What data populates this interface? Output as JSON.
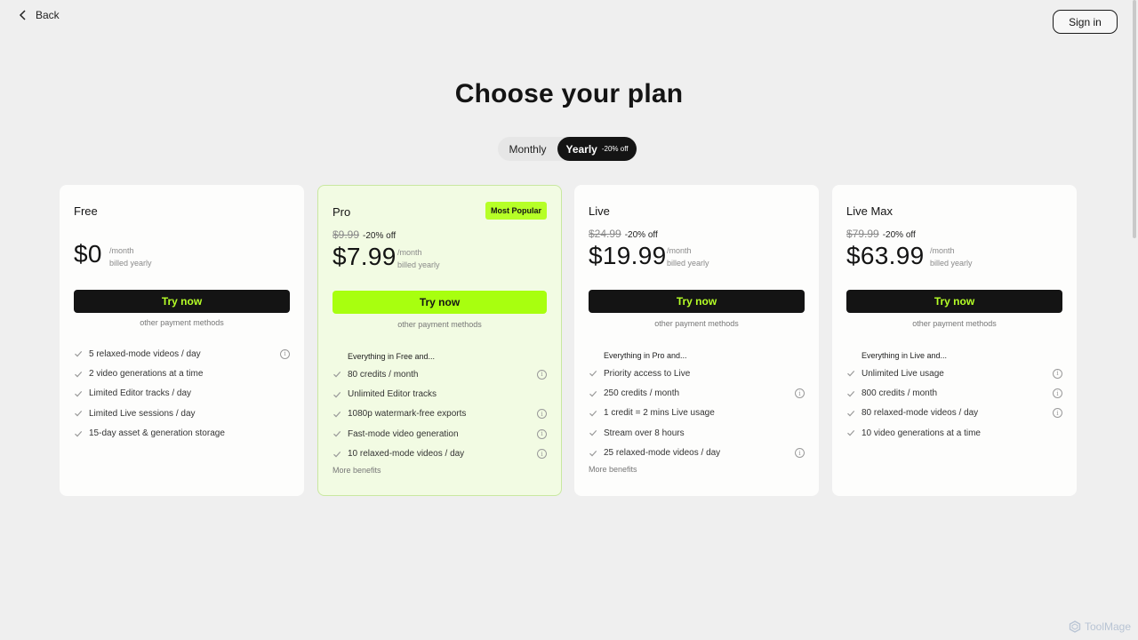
{
  "nav": {
    "back_label": "Back",
    "signin_label": "Sign in"
  },
  "title": "Choose your plan",
  "billing": {
    "monthly": "Monthly",
    "yearly": "Yearly",
    "yearly_discount": "-20% off",
    "selected": "Yearly"
  },
  "plans": [
    {
      "name": "Free",
      "badge": "",
      "old_price": "",
      "discount": "",
      "price": "$0",
      "per": "/month",
      "billing_note": "billed yearly",
      "cta": "Try now",
      "other": "other payment methods",
      "features_heading": "",
      "features": [
        {
          "text": "5 relaxed-mode videos / day",
          "info": true
        },
        {
          "text": "2 video generations at a time",
          "info": false
        },
        {
          "text": "Limited Editor tracks / day",
          "info": false
        },
        {
          "text": "Limited Live sessions / day",
          "info": false
        },
        {
          "text": "15-day asset & generation storage",
          "info": false
        }
      ],
      "more": ""
    },
    {
      "name": "Pro",
      "badge": "Most Popular",
      "old_price": "$9.99",
      "discount": "-20% off",
      "price": "$7.99",
      "per": "/month",
      "billing_note": "billed yearly",
      "cta": "Try now",
      "other": "other payment methods",
      "features_heading": "Everything in Free and...",
      "features": [
        {
          "text": "80 credits / month",
          "info": true
        },
        {
          "text": "Unlimited Editor tracks",
          "info": false
        },
        {
          "text": "1080p watermark-free exports",
          "info": true
        },
        {
          "text": "Fast-mode video generation",
          "info": true
        },
        {
          "text": "10 relaxed-mode videos / day",
          "info": true
        }
      ],
      "more": "More benefits"
    },
    {
      "name": "Live",
      "badge": "",
      "old_price": "$24.99",
      "discount": "-20% off",
      "price": "$19.99",
      "per": "/month",
      "billing_note": "billed yearly",
      "cta": "Try now",
      "other": "other payment methods",
      "features_heading": "Everything in Pro and...",
      "features": [
        {
          "text": "Priority access to Live",
          "info": false
        },
        {
          "text": "250 credits / month",
          "info": true
        },
        {
          "text": "1 credit = 2 mins Live usage",
          "info": false
        },
        {
          "text": "Stream over 8 hours",
          "info": false
        },
        {
          "text": "25 relaxed-mode videos / day",
          "info": true
        }
      ],
      "more": "More benefits"
    },
    {
      "name": "Live Max",
      "badge": "",
      "old_price": "$79.99",
      "discount": "-20% off",
      "price": "$63.99",
      "per": "/month",
      "billing_note": "billed yearly",
      "cta": "Try now",
      "other": "other payment methods",
      "features_heading": "Everything in Live and...",
      "features": [
        {
          "text": "Unlimited Live usage",
          "info": true
        },
        {
          "text": "800 credits / month",
          "info": true
        },
        {
          "text": "80 relaxed-mode videos / day",
          "info": true
        },
        {
          "text": "10 video generations at a time",
          "info": false
        }
      ],
      "more": ""
    }
  ],
  "watermark": "ToolMage",
  "colors": {
    "accent": "#b6ff27",
    "dark": "#141414",
    "background": "#efefef",
    "pro_card": "#f2fbe3"
  }
}
